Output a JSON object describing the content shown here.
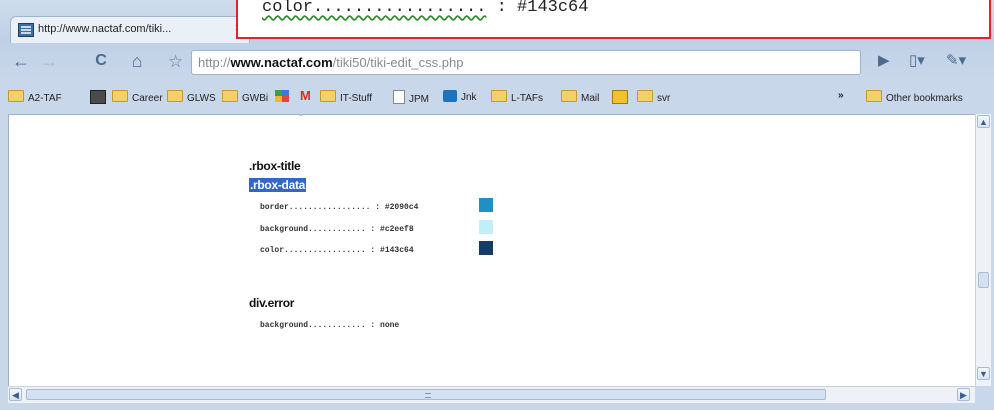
{
  "tab": {
    "title": "http://www.nactaf.com/tiki...",
    "close": "×"
  },
  "zoom_overlay": {
    "dots": "color.................",
    "sep": " : ",
    "value": "#143c64"
  },
  "toolbar": {
    "back": "←",
    "forward": "→",
    "reload": "C",
    "home": "⌂",
    "star": "☆",
    "url_prefix": "http://",
    "url_domain": "www.nactaf.com",
    "url_path": "/tiki50/tiki-edit_css.php",
    "go": "▶",
    "page_menu": "▯▾",
    "tools_menu": "✎▾"
  },
  "bookmarks": {
    "items": [
      "A2-TAF",
      "Career",
      "GLWS",
      "GWBi",
      "IT-Stuff",
      "JPM",
      "Jnk",
      "L-TAFs",
      "Mail",
      "svr"
    ],
    "overflow": "»",
    "other": "Other bookmarks"
  },
  "page": {
    "selector_title": ".rbox-title",
    "selector_data": ".rbox-data",
    "rbox_props": [
      {
        "text": "border................. : #2090c4",
        "color": "#2090c4"
      },
      {
        "text": "background............ : #c2eef8",
        "color": "#c2eef8"
      },
      {
        "text": "color................. : #143c64",
        "color": "#143c64"
      }
    ],
    "selector_error": "div.error",
    "error_prop": "background............ : none"
  },
  "scroll": {
    "up": "▲",
    "down": "▼",
    "left": "◀",
    "right": "▶"
  }
}
